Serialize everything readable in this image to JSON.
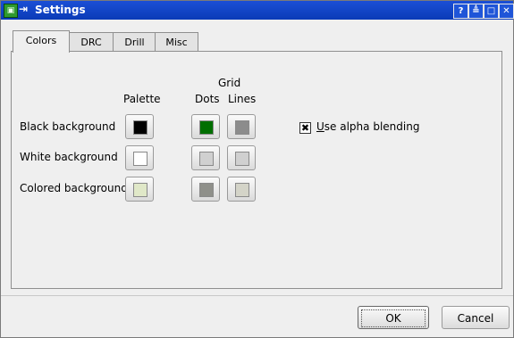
{
  "window": {
    "title": "Settings"
  },
  "titlebar_buttons": {
    "help": "?",
    "shade": "≜",
    "maximize": "□",
    "close": "✕"
  },
  "tabs": [
    {
      "label": "Colors",
      "active": true
    },
    {
      "label": "DRC",
      "active": false
    },
    {
      "label": "Drill",
      "active": false
    },
    {
      "label": "Misc",
      "active": false
    }
  ],
  "headers": {
    "grid": "Grid",
    "palette": "Palette",
    "dots": "Dots",
    "lines": "Lines"
  },
  "rows": [
    {
      "label": "Black background",
      "palette_color": "#000000",
      "dots_color": "#006f00",
      "lines_color": "#8c8c8c"
    },
    {
      "label": "White background",
      "palette_color": "#ffffff",
      "dots_color": "#d0d0d0",
      "lines_color": "#d0d0d0"
    },
    {
      "label": "Colored background",
      "palette_color": "#e0e8c8",
      "dots_color": "#8f908a",
      "lines_color": "#d4d4c8"
    }
  ],
  "alpha_blending": {
    "label_first": "U",
    "label_rest": "se alpha blending",
    "checked": true
  },
  "buttons": {
    "ok": "OK",
    "cancel": "Cancel"
  }
}
